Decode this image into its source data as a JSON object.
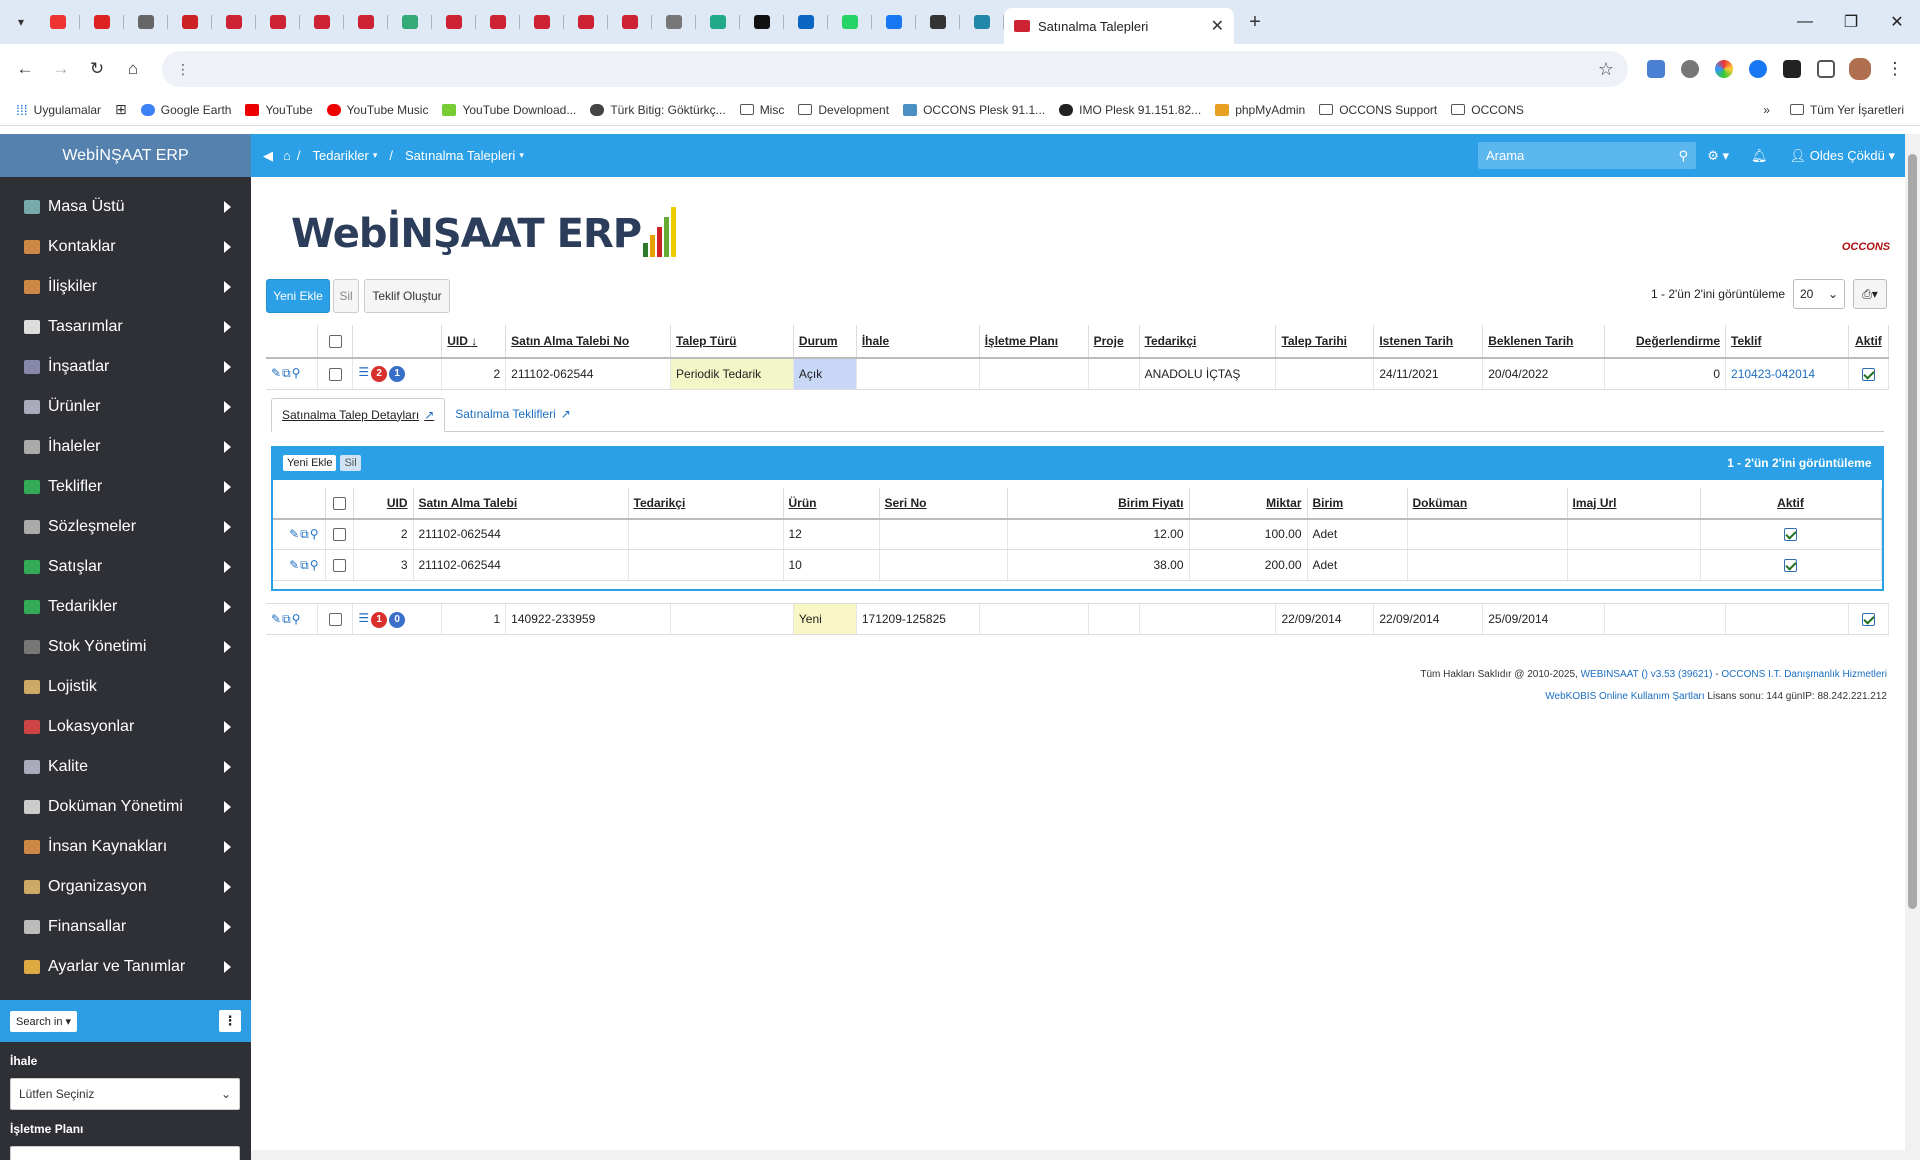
{
  "browser": {
    "tab_count_pinned": 24,
    "active_tab_title": "Satınalma Talepleri",
    "bookmarks": [
      "Uygulamalar",
      "Google Earth",
      "YouTube",
      "YouTube Music",
      "YouTube Download...",
      "Türk Bitig: Göktürkç...",
      "Misc",
      "Development",
      "OCCONS Plesk 91.1...",
      "IMO Plesk 91.151.82...",
      "phpMyAdmin",
      "OCCONS Support",
      "OCCONS"
    ],
    "bookmarks_right": "Tüm Yer İşaretleri"
  },
  "sidebar": {
    "title": "WebİNŞAAT ERP",
    "items": [
      "Masa Üstü",
      "Kontaklar",
      "İlişkiler",
      "Tasarımlar",
      "İnşaatlar",
      "Ürünler",
      "İhaleler",
      "Teklifler",
      "Sözleşmeler",
      "Satışlar",
      "Tedarikler",
      "Stok Yönetimi",
      "Lojistik",
      "Lokasyonlar",
      "Kalite",
      "Doküman Yönetimi",
      "İnsan Kaynakları",
      "Organizasyon",
      "Finansallar",
      "Ayarlar ve Tanımlar"
    ],
    "search_in": "Search in",
    "filter1_label": "İhale",
    "filter1_value": "Lütfen Seçiniz",
    "filter2_label": "İşletme Planı"
  },
  "topnav": {
    "crumb1": "Tedarikler",
    "crumb2": "Satınalma Talepleri",
    "search_placeholder": "Arama",
    "user": "Oldes Çökdü"
  },
  "logo": {
    "text": "WebİNŞAAT ERP",
    "occons": "OCCONS"
  },
  "toolbar": {
    "add": "Yeni Ekle",
    "delete": "Sil",
    "quote": "Teklif Oluştur"
  },
  "pager": {
    "text": "1 - 2'ün 2'ini görüntüleme",
    "size": "20"
  },
  "table": {
    "headers": [
      "UID",
      "Satın Alma Talebi No",
      "Talep Türü",
      "Durum",
      "İhale",
      "İşletme Planı",
      "Proje",
      "Tedarikçi",
      "Talep Tarihi",
      "Istenen Tarih",
      "Beklenen Tarih",
      "Değerlendirme",
      "Teklif",
      "Aktif"
    ],
    "rows": [
      {
        "badge1": "2",
        "badge2": "1",
        "uid": "2",
        "no": "211102-062544",
        "tur": "Periodik Tedarik",
        "durum": "Açık",
        "ihale": "",
        "plan": "",
        "proje": "",
        "tedarikci": "ANADOLU İÇTAŞ",
        "talep_tarihi": "",
        "istenen": "24/11/2021",
        "beklenen": "20/04/2022",
        "deger": "0",
        "teklif": "210423-042014"
      },
      {
        "badge1": "1",
        "badge2": "0",
        "uid": "1",
        "no": "140922-233959",
        "tur": "",
        "durum": "Yeni",
        "ihale": "171209-125825",
        "plan": "",
        "proje": "",
        "tedarikci": "",
        "talep_tarihi": "22/09/2014",
        "istenen": "22/09/2014",
        "beklenen": "25/09/2014",
        "deger": "",
        "teklif": ""
      }
    ]
  },
  "subtabs": {
    "tab1": "Satınalma Talep Detayları",
    "tab2": "Satınalma Teklifleri"
  },
  "subpanel": {
    "add": "Yeni Ekle",
    "delete": "Sil",
    "pager": "1 - 2'ün 2'ini görüntüleme",
    "headers": [
      "UID",
      "Satın Alma Talebi",
      "Tedarikçi",
      "Ürün",
      "Seri No",
      "Birim Fiyatı",
      "Miktar",
      "Birim",
      "Doküman",
      "Imaj Url",
      "Aktif"
    ],
    "rows": [
      {
        "uid": "2",
        "talep": "211102-062544",
        "tedarikci": "",
        "urun": "12",
        "seri": "",
        "fiyat": "12.00",
        "miktar": "100.00",
        "birim": "Adet",
        "dokuman": "",
        "imaj": ""
      },
      {
        "uid": "3",
        "talep": "211102-062544",
        "tedarikci": "",
        "urun": "10",
        "seri": "",
        "fiyat": "38.00",
        "miktar": "200.00",
        "birim": "Adet",
        "dokuman": "",
        "imaj": ""
      }
    ]
  },
  "footer": {
    "line1_prefix": "Tüm Hakları Saklıdır @ 2010-2025,",
    "line1_link1": "WEBINSAAT () v3.53 (39621)",
    "line1_sep": "-",
    "line1_link2": "OCCONS I.T. Danışmanlık Hizmetleri",
    "line2_link": "WebKOBIS Online Kullanım Şartları",
    "line2_text": "Lisans sonu: 144 günIP: 88.242.221.212"
  }
}
